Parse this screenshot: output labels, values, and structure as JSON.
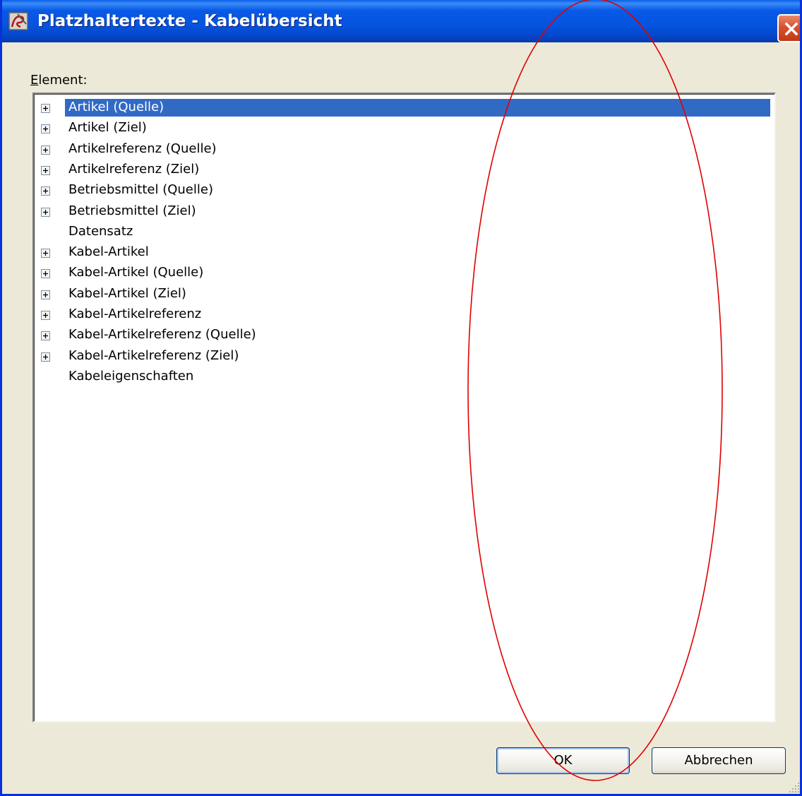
{
  "window": {
    "title": "Platzhaltertexte - Kabelübersicht",
    "app_icon": "app-icon",
    "close_icon": "close-icon"
  },
  "tree": {
    "label_accesskey": "E",
    "label_rest": "lement:",
    "items": [
      {
        "label": "Artikel (Quelle)",
        "expandable": true,
        "selected": true
      },
      {
        "label": "Artikel (Ziel)",
        "expandable": true,
        "selected": false
      },
      {
        "label": "Artikelreferenz (Quelle)",
        "expandable": true,
        "selected": false
      },
      {
        "label": "Artikelreferenz (Ziel)",
        "expandable": true,
        "selected": false
      },
      {
        "label": "Betriebsmittel (Quelle)",
        "expandable": true,
        "selected": false
      },
      {
        "label": "Betriebsmittel (Ziel)",
        "expandable": true,
        "selected": false
      },
      {
        "label": "Datensatz",
        "expandable": false,
        "selected": false
      },
      {
        "label": "Kabel-Artikel",
        "expandable": true,
        "selected": false
      },
      {
        "label": "Kabel-Artikel (Quelle)",
        "expandable": true,
        "selected": false
      },
      {
        "label": "Kabel-Artikel (Ziel)",
        "expandable": true,
        "selected": false
      },
      {
        "label": "Kabel-Artikelreferenz",
        "expandable": true,
        "selected": false
      },
      {
        "label": "Kabel-Artikelreferenz (Quelle)",
        "expandable": true,
        "selected": false
      },
      {
        "label": "Kabel-Artikelreferenz (Ziel)",
        "expandable": true,
        "selected": false
      },
      {
        "label": "Kabeleigenschaften",
        "expandable": false,
        "selected": false
      }
    ]
  },
  "buttons": {
    "ok": "OK",
    "cancel": "Abbrechen"
  },
  "side_mark": "A",
  "colors": {
    "selection": "#316ac5",
    "annotation": "#e00000"
  }
}
